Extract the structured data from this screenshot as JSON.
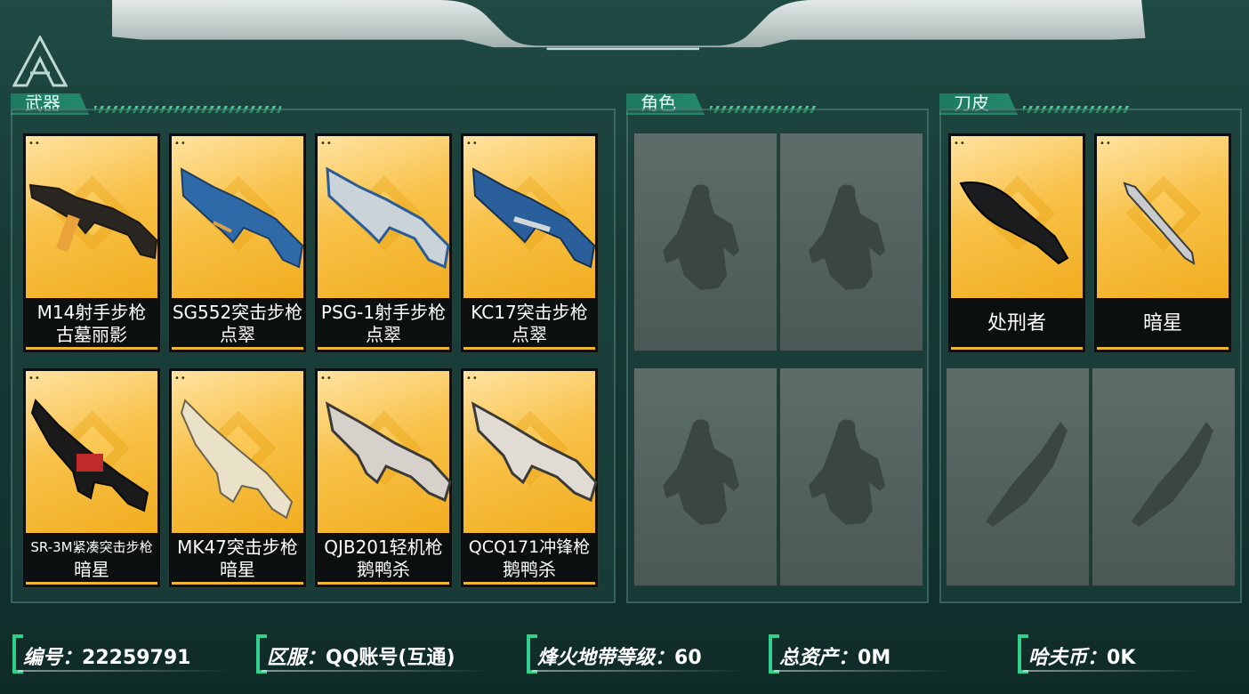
{
  "sections": {
    "weapons_title": "武器",
    "characters_title": "角色",
    "knives_title": "刀皮"
  },
  "weapons": [
    {
      "line1": "M14射手步枪",
      "line2": "古墓丽影"
    },
    {
      "line1": "SG552突击步枪",
      "line2": "点翠"
    },
    {
      "line1": "PSG-1射手步枪",
      "line2": "点翠"
    },
    {
      "line1": "KC17突击步枪",
      "line2": "点翠"
    },
    {
      "line1": "SR-3M紧凑突击步枪",
      "line2": "暗星"
    },
    {
      "line1": "MK47突击步枪",
      "line2": "暗星"
    },
    {
      "line1": "QJB201轻机枪",
      "line2": "鹅鸭杀"
    },
    {
      "line1": "QCQ171冲锋枪",
      "line2": "鹅鸭杀"
    }
  ],
  "knives": [
    {
      "name": "处刑者"
    },
    {
      "name": "暗星"
    }
  ],
  "info_bar": {
    "id_label": "编号：",
    "id_value": "22259791",
    "server_label": "区服：",
    "server_value": "QQ账号(互通)",
    "level_label": "烽火地带等级：",
    "level_value": "60",
    "assets_label": "总资产：",
    "assets_value": "0M",
    "coin_label": "哈夫币：",
    "coin_value": "0K"
  },
  "colors": {
    "accent": "#2fd08c",
    "card_gold": "#f4b832",
    "panel": "#1e4640"
  }
}
